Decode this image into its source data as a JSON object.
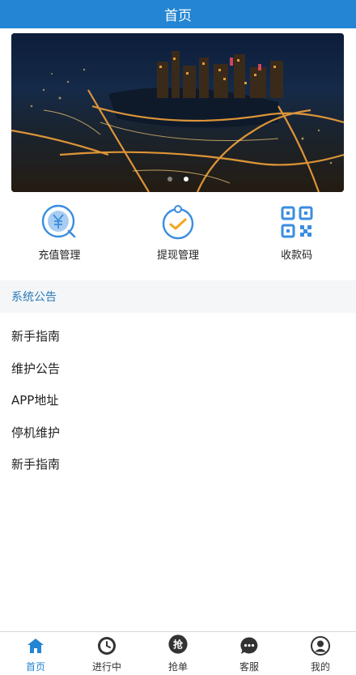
{
  "header": {
    "title": "首页"
  },
  "banner": {
    "slides": 2,
    "active_slide": 2
  },
  "quick_actions": [
    {
      "label": "充值管理",
      "icon": "recharge-yen-icon"
    },
    {
      "label": "提现管理",
      "icon": "withdraw-check-icon"
    },
    {
      "label": "收款码",
      "icon": "qr-code-icon"
    }
  ],
  "notices": {
    "title": "系统公告",
    "items": [
      "新手指南",
      "维护公告",
      "APP地址",
      "停机维护",
      "新手指南"
    ]
  },
  "tabbar": [
    {
      "label": "首页",
      "icon": "home-icon",
      "active": true
    },
    {
      "label": "进行中",
      "icon": "clock-icon",
      "active": false
    },
    {
      "label": "抢单",
      "icon": "grab-order-icon",
      "active": false
    },
    {
      "label": "客服",
      "icon": "chat-icon",
      "active": false
    },
    {
      "label": "我的",
      "icon": "profile-icon",
      "active": false
    }
  ],
  "colors": {
    "primary": "#2385d3",
    "notice_title": "#2a7ab8",
    "notice_bg": "#f4f6f8"
  }
}
